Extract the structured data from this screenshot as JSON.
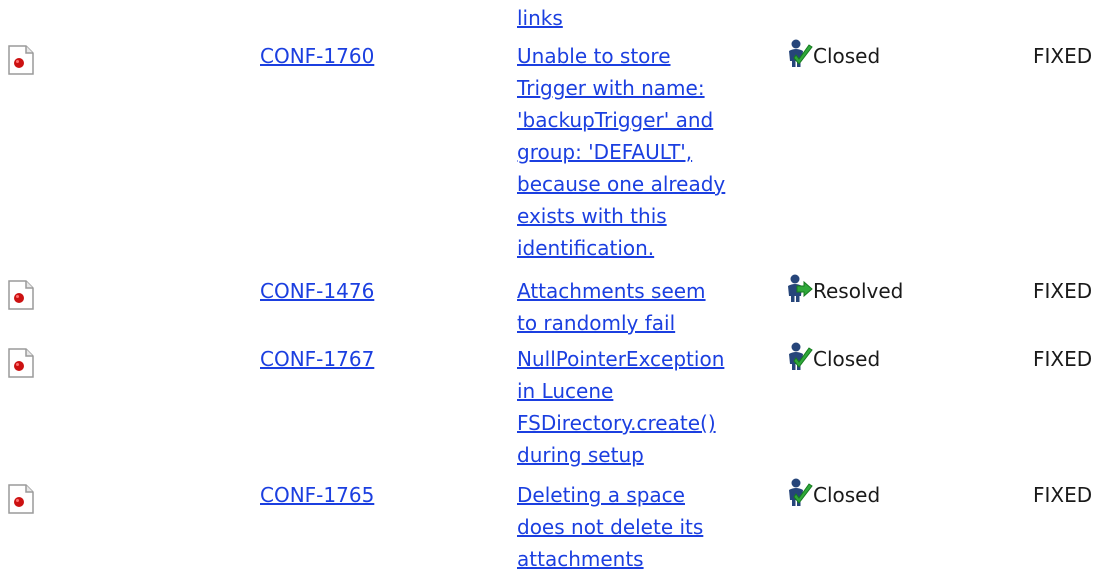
{
  "top_fragment": "links",
  "colors": {
    "link": "#1b3fe0",
    "bug_red": "#cc1111",
    "closed_check": "#2fa83a",
    "resolved_arrow": "#2fa83a",
    "person_blue": "#26457a"
  },
  "issues": [
    {
      "type_icon": "bug-icon",
      "key": "CONF-1760",
      "summary_lines": [
        "Unable to store",
        "Trigger with name:",
        "'backupTrigger' and",
        "group: 'DEFAULT',",
        "because one already",
        "exists with this",
        "identification."
      ],
      "status_icon": "closed-status-icon",
      "status": "Closed",
      "resolution": "FIXED"
    },
    {
      "type_icon": "bug-icon",
      "key": "CONF-1476",
      "summary_lines": [
        "Attachments seem",
        "to randomly fail"
      ],
      "status_icon": "resolved-status-icon",
      "status": "Resolved",
      "resolution": "FIXED"
    },
    {
      "type_icon": "bug-icon",
      "key": "CONF-1767",
      "summary_lines": [
        "NullPointerException",
        "in Lucene",
        "FSDirectory.create()",
        "during setup"
      ],
      "status_icon": "closed-status-icon",
      "status": "Closed",
      "resolution": "FIXED"
    },
    {
      "type_icon": "bug-icon",
      "key": "CONF-1765",
      "summary_lines": [
        "Deleting a space",
        "does not delete its",
        "attachments"
      ],
      "status_icon": "closed-status-icon",
      "status": "Closed",
      "resolution": "FIXED"
    }
  ]
}
